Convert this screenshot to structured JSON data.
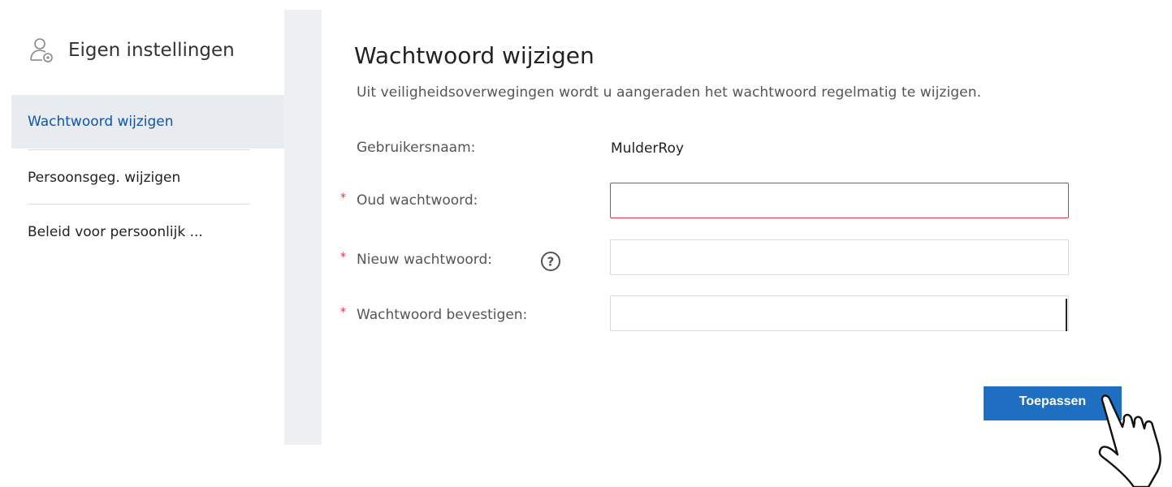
{
  "sidebar": {
    "title": "Eigen instellingen",
    "items": [
      {
        "label": "Wachtwoord wijzigen",
        "active": true
      },
      {
        "label": "Persoonsgeg. wijzigen",
        "active": false
      },
      {
        "label": "Beleid voor persoonlijk ...",
        "active": false
      }
    ]
  },
  "main": {
    "title": "Wachtwoord wijzigen",
    "subtitle": "Uit veiligheidsoverwegingen wordt u aangeraden het wachtwoord regelmatig te wijzigen.",
    "username_label": "Gebruikersnaam:",
    "username_value": "MulderRoy",
    "required_mark": "*",
    "old_password_label": "Oud wachtwoord:",
    "new_password_label": "Nieuw wachtwoord:",
    "confirm_password_label": "Wachtwoord bevestigen:",
    "help_glyph": "?",
    "apply_label": "Toepassen"
  },
  "colors": {
    "accent": "#1e6fc2",
    "active_nav_text": "#0e56a8",
    "error": "#d9363e"
  }
}
